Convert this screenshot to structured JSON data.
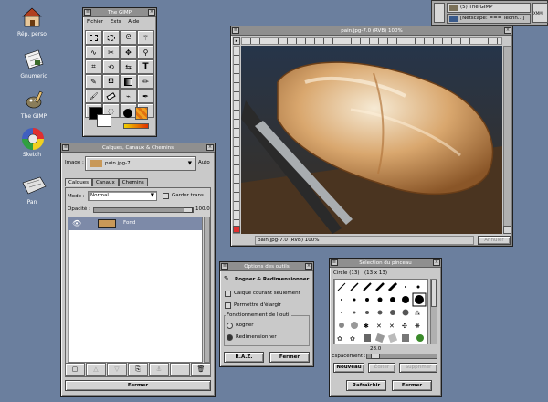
{
  "desktop": {
    "icons": [
      {
        "label": "Rép. perso",
        "icon": "house-icon"
      },
      {
        "label": "Gnumeric",
        "icon": "spreadsheet-icon"
      },
      {
        "label": "The GIMP",
        "icon": "gimp-icon"
      },
      {
        "label": "Sketch",
        "icon": "color-wheel-icon"
      },
      {
        "label": "Pan",
        "icon": "newsreader-icon"
      }
    ]
  },
  "taskbar": {
    "tasks": [
      "(5) The GIMP",
      "[Netscape: === Techn...]",
      "XMM"
    ]
  },
  "toolbox": {
    "title": "The GIMP",
    "menus": [
      "Fichier",
      "Exts",
      "Aide"
    ]
  },
  "image_window": {
    "title": "pain.jpg-7.0 (RVB) 100%",
    "status": "pain.jpg-7.0 (RVB) 100%",
    "cancel_label": "Annuler"
  },
  "layers": {
    "title": "Calques, Canaux & Chemins",
    "image_label": "Image :",
    "image_value": "pain.jpg-7",
    "auto_label": "Auto",
    "tabs": [
      "Calques",
      "Canaux",
      "Chemins"
    ],
    "mode_label": "Mode :",
    "mode_value": "Normal",
    "keep_trans_label": "Garder trans.",
    "opacity_label": "Opacité :",
    "opacity_value": "100.0",
    "layer_name": "Fond",
    "close_label": "Fermer"
  },
  "tool_options": {
    "title": "Options des outils",
    "heading": "Rogner & Redimensionner",
    "current_layer_only": "Calque courant seulement",
    "allow_enlarge": "Permettre d'élargir",
    "tool_mode_label": "Fonctionnement de l'outil",
    "mode_crop": "Rogner",
    "mode_resize": "Redimensionner",
    "reset_label": "R.À.Z.",
    "close_label": "Fermer"
  },
  "brushes": {
    "title": "Sélection du pinceau",
    "brush_name": "Circle (13)",
    "brush_size": "(13 x 13)",
    "spacing_value": "28.0",
    "spacing_label": "Espacement :",
    "new_label": "Nouveau",
    "edit_label": "Éditer",
    "delete_label": "Supprimer",
    "refresh_label": "Rafraîchir",
    "close_label": "Fermer"
  }
}
